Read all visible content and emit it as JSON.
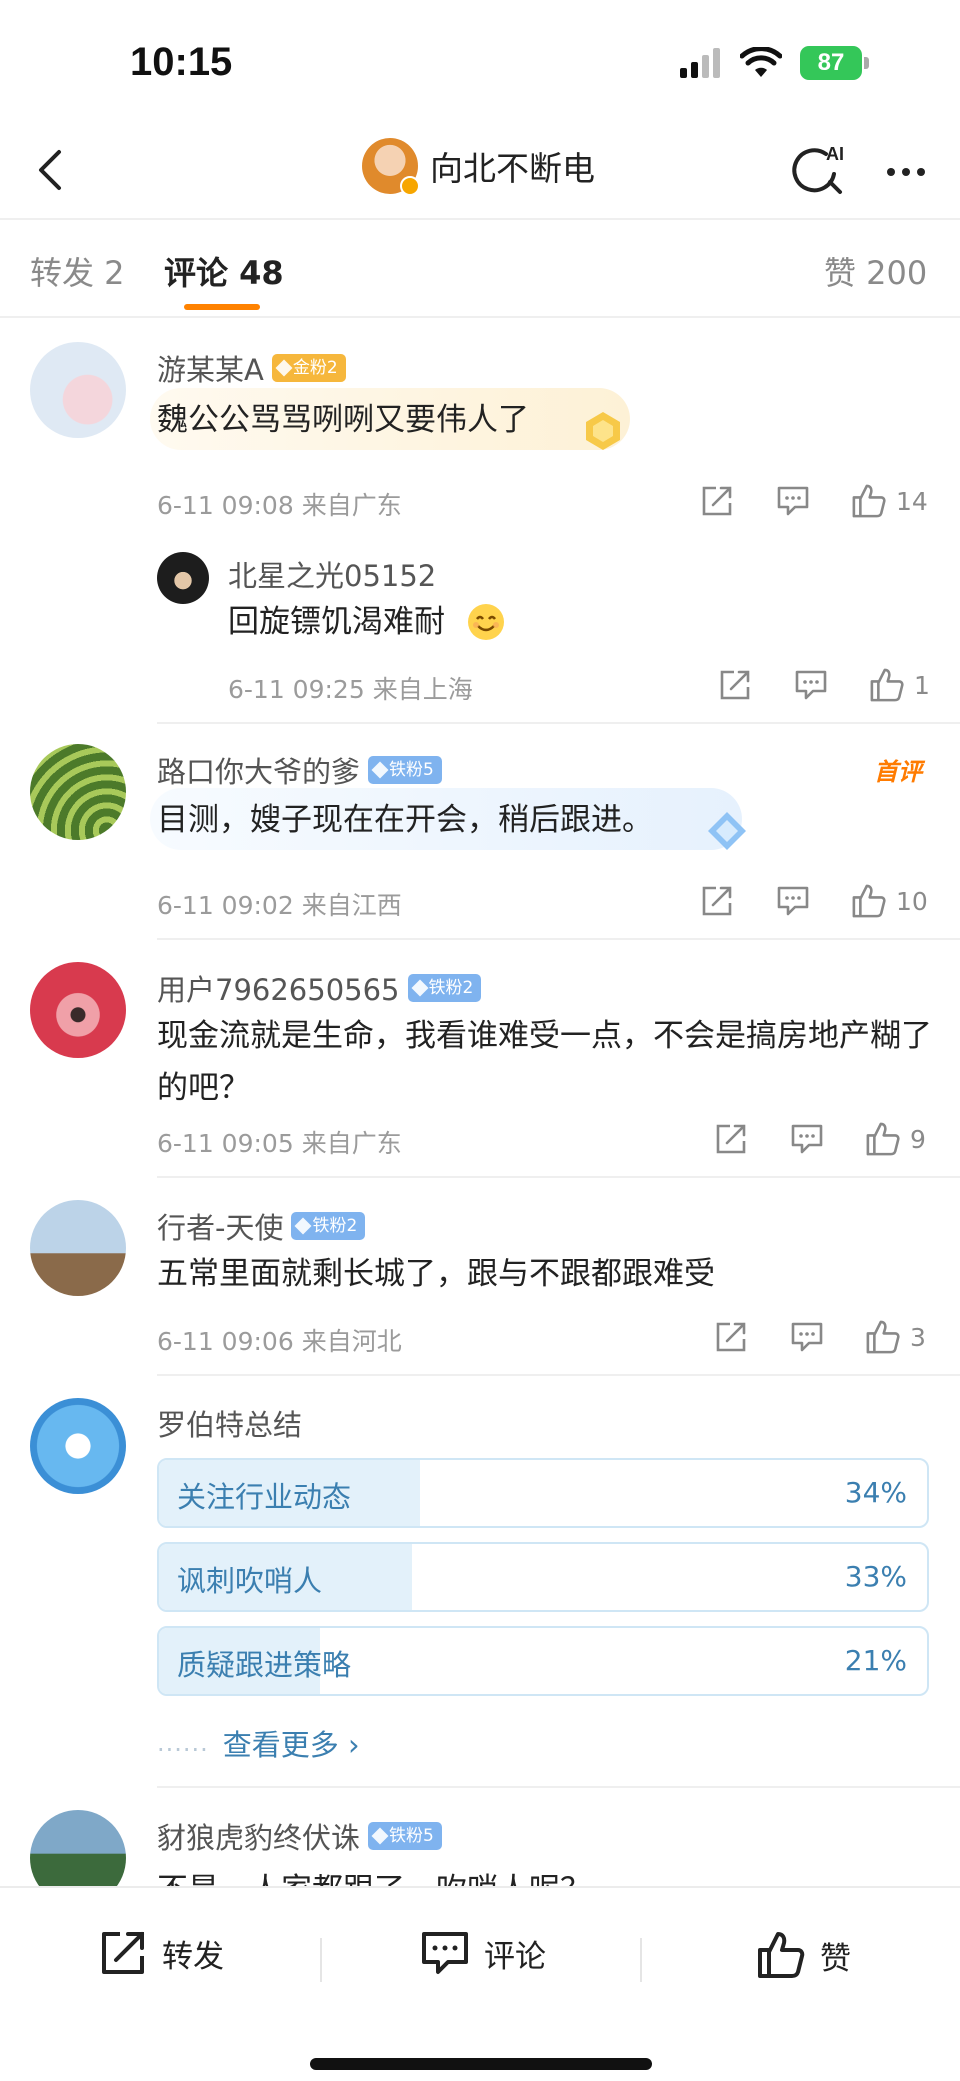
{
  "status": {
    "time": "10:15",
    "battery": "87"
  },
  "nav": {
    "title": "向北不断电",
    "ai_label": "AI"
  },
  "tabs": {
    "repost": "转发 2",
    "comment": "评论 48",
    "like": "赞 200"
  },
  "comments": [
    {
      "user": "游某某A",
      "badge": "金粉2",
      "text": "魏公公骂骂咧咧又要伟人了",
      "time": "6-11 09:08",
      "loc": "来自广东",
      "likes": "14"
    },
    {
      "user": "路口你大爷的爹",
      "badge": "铁粉5",
      "tag": "首评",
      "text": "目测，嫂子现在在开会，稍后跟进。",
      "time": "6-11 09:02",
      "loc": "来自江西",
      "likes": "10"
    },
    {
      "user": "用户7962650565",
      "badge": "铁粉2",
      "text": "现金流就是生命，我看谁难受一点，不会是搞房地产糊了的吧？",
      "time": "6-11 09:05",
      "loc": "来自广东",
      "likes": "9"
    },
    {
      "user": "行者-天使",
      "badge": "铁粉2",
      "text": "五常里面就剩长城了，跟与不跟都跟难受",
      "time": "6-11 09:06",
      "loc": "来自河北",
      "likes": "3"
    },
    {
      "user": "豺狼虎豹终伏诛",
      "badge": "铁粉5",
      "text": "不是，人家都跟了，吹哨人呢？"
    }
  ],
  "reply": {
    "user": "北星之光05152",
    "text": "回旋镖饥渴难耐",
    "time": "6-11 09:25",
    "loc": "来自上海",
    "likes": "1"
  },
  "summary": {
    "title": "罗伯特总结",
    "options": [
      {
        "label": "关注行业动态",
        "pct_text": "34%",
        "fraction": 0.34
      },
      {
        "label": "讽刺吹哨人",
        "pct_text": "33%",
        "fraction": 0.33
      },
      {
        "label": "质疑跟进策略",
        "pct_text": "21%",
        "fraction": 0.21
      }
    ],
    "see_more": "查看更多 ›"
  },
  "bottom": {
    "repost": "转发",
    "comment": "评论",
    "like": "赞"
  },
  "colors": {
    "accent": "#ff8200",
    "link": "#3b7fb0",
    "badge_gold": "#f6b73c",
    "badge_iron": "#7fb3ef"
  }
}
